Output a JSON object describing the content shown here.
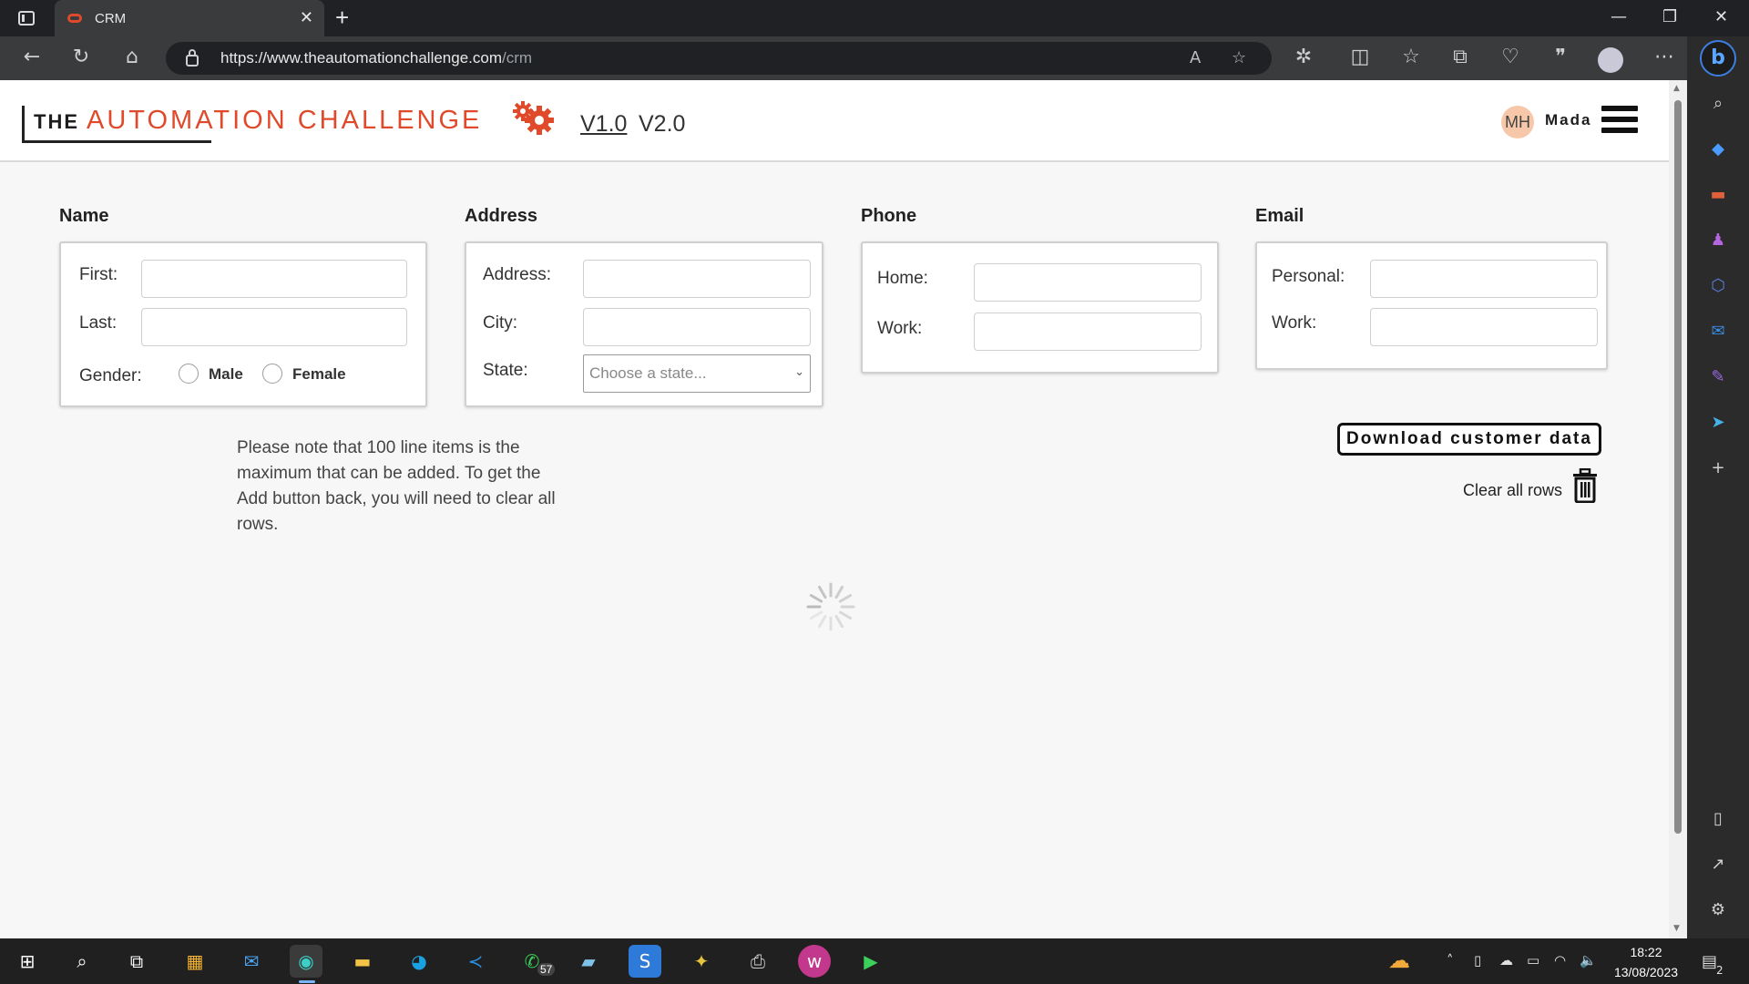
{
  "browser": {
    "tab_title": "CRM",
    "url_host": "https://www.theautomationchallenge.com",
    "url_path": "/crm"
  },
  "header": {
    "logo_the": "THE",
    "logo_main": "AUTOMATION CHALLENGE",
    "versions": [
      "V1.0",
      "V2.0"
    ],
    "active_version": "V1.0",
    "avatar_initials": "MH",
    "user_name": "Mada"
  },
  "name_section": {
    "title": "Name",
    "first_label": "First:",
    "first_value": "",
    "last_label": "Last:",
    "last_value": "",
    "gender_label": "Gender:",
    "gender_options": [
      "Male",
      "Female"
    ]
  },
  "address_section": {
    "title": "Address",
    "address_label": "Address:",
    "city_label": "City:",
    "state_label": "State:",
    "state_placeholder": "Choose a state..."
  },
  "phone_section": {
    "title": "Phone",
    "home_label": "Home:",
    "work_label": "Work:"
  },
  "email_section": {
    "title": "Email",
    "personal_label": "Personal:",
    "work_label": "Work:"
  },
  "note": "Please note that 100 line items is the maximum that can be added. To get the Add button back, you will need to clear all rows.",
  "actions": {
    "download_label": "Download customer data",
    "clear_label": "Clear all rows"
  },
  "taskbar": {
    "time": "18:22",
    "date": "13/08/2023",
    "whatsapp_badge": "57",
    "notifications": "2"
  },
  "colors": {
    "brand": "#e04a2b",
    "taskbar": "#202020",
    "chrome": "#3a3b3d"
  }
}
